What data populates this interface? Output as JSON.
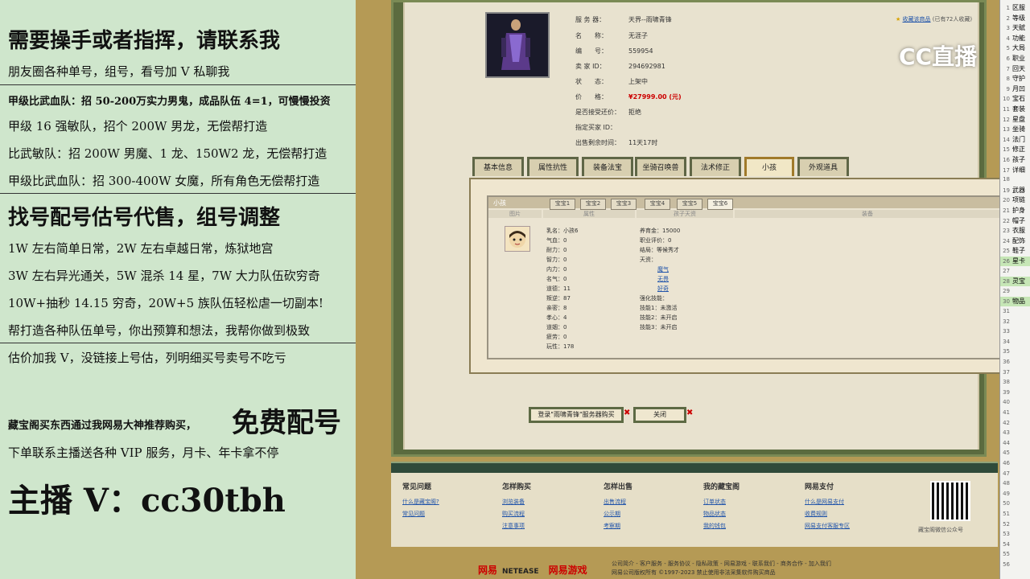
{
  "promo": {
    "line1": "需要操手或者指挥，请联系我",
    "line2": "朋友圈各种单号，组号，看号加 V 私聊我",
    "line3": "甲级比武血队：招 50-200万实力男鬼，成品队伍 4=1，可慢慢投资",
    "line4": "甲级 16 强敏队，招个 200W 男龙，无偿帮打造",
    "line5": "比武敏队：招 200W 男魔、1 龙、150W2 龙，无偿帮打造",
    "line6": "甲级比武血队：招 300-400W 女魔，所有角色无偿帮打造",
    "line7": "找号配号估号代售，组号调整",
    "line8": "1W 左右简单日常，2W 左右卓越日常，炼狱地宫",
    "line9": "3W 左右异光通关，5W 混杀 14 星，7W 大力队伍砍穷奇",
    "line10": "10W+抽秒 14.15 穷奇，20W+5 族队伍轻松虐一切副本!",
    "line11": "帮打造各种队伍单号，你出预算和想法，我帮你做到极致",
    "line12": "估价加我 V，没链接上号估，列明细买号卖号不吃亏",
    "line13a": "藏宝阁买东西通过我网易大神推荐购买，",
    "line13b": "免费配号",
    "line14": "下单联系主播送各种 VIP 服务，月卡、年卡拿不停",
    "line15": "主播 V：cc30tbh"
  },
  "cc_logo": "CC直播",
  "item": {
    "favorite_link": "收藏该商品",
    "favorite_count": "(已有72人收藏)",
    "rows": [
      {
        "k": "服 务 器：",
        "v": "天界--雨啸青锋"
      },
      {
        "k": "名　　称：",
        "v": "无涯子"
      },
      {
        "k": "编　　号：",
        "v": "559954"
      },
      {
        "k": "卖 家 ID：",
        "v": "294692981"
      },
      {
        "k": "状　　态：",
        "v": "上架中"
      },
      {
        "k": "价　　格：",
        "v": "¥27999.00 (元)"
      },
      {
        "k": "是否接受还价：",
        "v": "拒绝"
      },
      {
        "k": "指定买家 ID：",
        "v": ""
      },
      {
        "k": "出售剩余时间：",
        "v": "11天17时"
      }
    ]
  },
  "tabs": [
    "基本信息",
    "属性抗性",
    "装备法宝",
    "坐骑召唤兽",
    "法术修正",
    "小孩",
    "外观道具"
  ],
  "child": {
    "title": "小孩",
    "subtabs": [
      "宝宝1",
      "宝宝2",
      "宝宝3",
      "宝宝4",
      "宝宝5",
      "宝宝6"
    ],
    "columns": [
      "图片",
      "属性",
      "孩子天资",
      "装备"
    ],
    "attrs_left": [
      "乳名：小孩6",
      "气血：0",
      "耐力：0",
      "智力：0",
      "内力：0",
      "名气：0",
      "道德：11",
      "叛逆：87",
      "亲密：8",
      "孝心：4",
      "道姻：0",
      "疲劳：0",
      "玩性：178"
    ],
    "attrs_right_top": [
      "养育金：15000",
      "职业评价：0",
      "结局：等候秀才",
      "天资："
    ],
    "talents": [
      "魔气",
      "无畏",
      "好奇"
    ],
    "attrs_right_bottom": [
      "强化技能：",
      "技能1：未激活",
      "技能2：未开启",
      "技能3：未开启"
    ]
  },
  "buttons": {
    "login": "登录\"雨啸青锋\"服务器购买",
    "close": "关闭",
    "x": "✖"
  },
  "footer": {
    "cols": [
      {
        "h": "常见问题",
        "links": [
          "什么是藏宝阁?",
          "常见问题"
        ]
      },
      {
        "h": "怎样购买",
        "links": [
          "浏览装备",
          "购买流程",
          "注意事项"
        ]
      },
      {
        "h": "怎样出售",
        "links": [
          "出售流程",
          "公示期",
          "考察期"
        ]
      },
      {
        "h": "我的藏宝阁",
        "links": [
          "订单状态",
          "物品状态",
          "我的钱包"
        ]
      },
      {
        "h": "网易支付",
        "links": [
          "什么是网易支付",
          "收费规则",
          "网易支付客服专区"
        ]
      }
    ],
    "qr_label": "藏宝阁微信公众号",
    "logo_a": "网易",
    "logo_b": "NETEASE",
    "logo_c": "网易游戏",
    "links_line1": "公司简介 - 客户服务 - 服务协议 - 隐私政策 - 网易游戏 - 联系我们 - 商务合作 - 加入我们",
    "links_line2": "网易公司版权所有 ©1997-2023 禁止使用非法采集软件购买商品"
  },
  "right_strip": [
    {
      "n": "1",
      "t": "区服"
    },
    {
      "n": "2",
      "t": "等级"
    },
    {
      "n": "3",
      "t": "天赋"
    },
    {
      "n": "4",
      "t": "功能"
    },
    {
      "n": "5",
      "t": "大局"
    },
    {
      "n": "6",
      "t": "职业"
    },
    {
      "n": "7",
      "t": "回天"
    },
    {
      "n": "8",
      "t": "守护"
    },
    {
      "n": "9",
      "t": "月凹"
    },
    {
      "n": "10",
      "t": "宝石"
    },
    {
      "n": "11",
      "t": "套装"
    },
    {
      "n": "12",
      "t": "星盘"
    },
    {
      "n": "13",
      "t": "坐骑"
    },
    {
      "n": "14",
      "t": "法门"
    },
    {
      "n": "15",
      "t": "修正"
    },
    {
      "n": "16",
      "t": "孩子"
    },
    {
      "n": "17",
      "t": "详细"
    },
    {
      "n": "18",
      "t": ""
    },
    {
      "n": "19",
      "t": "武器"
    },
    {
      "n": "20",
      "t": "项链"
    },
    {
      "n": "21",
      "t": "护身"
    },
    {
      "n": "22",
      "t": "帽子"
    },
    {
      "n": "23",
      "t": "衣服"
    },
    {
      "n": "24",
      "t": "配饰"
    },
    {
      "n": "25",
      "t": "鞋子"
    },
    {
      "n": "26",
      "t": "星卡"
    },
    {
      "n": "27",
      "t": ""
    },
    {
      "n": "28",
      "t": "灵宝"
    },
    {
      "n": "29",
      "t": ""
    },
    {
      "n": "30",
      "t": "物品"
    },
    {
      "n": "31",
      "t": ""
    },
    {
      "n": "32",
      "t": ""
    },
    {
      "n": "33",
      "t": ""
    },
    {
      "n": "34",
      "t": ""
    },
    {
      "n": "35",
      "t": ""
    },
    {
      "n": "36",
      "t": ""
    },
    {
      "n": "37",
      "t": ""
    },
    {
      "n": "38",
      "t": ""
    },
    {
      "n": "39",
      "t": ""
    },
    {
      "n": "40",
      "t": ""
    },
    {
      "n": "41",
      "t": ""
    },
    {
      "n": "42",
      "t": ""
    },
    {
      "n": "43",
      "t": ""
    },
    {
      "n": "44",
      "t": ""
    },
    {
      "n": "45",
      "t": ""
    },
    {
      "n": "46",
      "t": ""
    },
    {
      "n": "47",
      "t": ""
    },
    {
      "n": "48",
      "t": ""
    },
    {
      "n": "49",
      "t": ""
    },
    {
      "n": "50",
      "t": ""
    },
    {
      "n": "51",
      "t": ""
    },
    {
      "n": "52",
      "t": ""
    },
    {
      "n": "53",
      "t": ""
    },
    {
      "n": "54",
      "t": ""
    },
    {
      "n": "55",
      "t": ""
    },
    {
      "n": "56",
      "t": ""
    }
  ]
}
